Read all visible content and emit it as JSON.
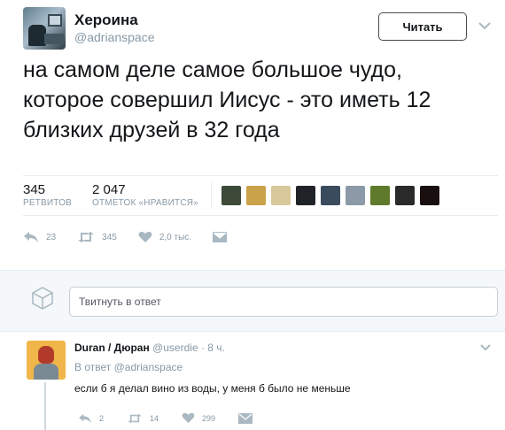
{
  "tweet": {
    "author_name": "Хероина",
    "author_handle": "@adrianspace",
    "follow_label": "Читать",
    "text": "на самом деле самое большое чудо, которое совершил Иисус - это иметь 12 близких друзей в 32 года",
    "retweets_count": "345",
    "retweets_label": "РЕТВИТОВ",
    "likes_count": "2 047",
    "likes_label": "ОТМЕТОК «НРАВИТСЯ»",
    "actions": {
      "reply_count": "23",
      "retweet_count": "345",
      "like_count": "2,0 тыс."
    }
  },
  "likers": [
    {
      "icon": "liker-avatar-1",
      "color": "#3d4a3a"
    },
    {
      "icon": "liker-avatar-2",
      "color": "#c9a24a"
    },
    {
      "icon": "liker-avatar-3",
      "color": "#d8c89a"
    },
    {
      "icon": "liker-avatar-4",
      "color": "#1f2226"
    },
    {
      "icon": "liker-avatar-5",
      "color": "#3a4b5e"
    },
    {
      "icon": "liker-avatar-6",
      "color": "#8b9aa6"
    },
    {
      "icon": "liker-avatar-7",
      "color": "#5f7a2a"
    },
    {
      "icon": "liker-avatar-8",
      "color": "#2a2a2a"
    },
    {
      "icon": "liker-avatar-9",
      "color": "#1a0f0f"
    }
  ],
  "reply_box": {
    "placeholder": "Твитнуть в ответ"
  },
  "reply": {
    "author_name": "Duran / Дюран",
    "author_handle": "@userdie",
    "time": "· 8 ч.",
    "in_reply_prefix": "В ответ",
    "in_reply_handle": "@adrianspace",
    "text": "если б я делал вино из воды, у меня б было не меньше",
    "actions": {
      "reply_count": "2",
      "retweet_count": "14",
      "like_count": "299"
    }
  },
  "colors": {
    "muted": "#8899a6",
    "text": "#14171a",
    "divider": "#e6ecf0",
    "icon": "#aab8c2"
  }
}
